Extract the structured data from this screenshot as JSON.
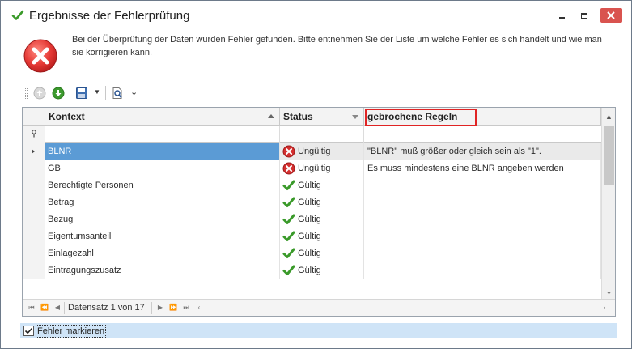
{
  "window": {
    "title": "Ergebnisse der Fehlerprüfung",
    "icon": "check-icon",
    "controls": [
      "minimize-icon",
      "maximize-icon",
      "close-icon"
    ]
  },
  "message": {
    "icon": "error-icon",
    "text": "Bei der Überprüfung der Daten wurden Fehler gefunden. Bitte entnehmen Sie der Liste um welche Fehler es sich handelt und wie man sie korrigieren kann."
  },
  "toolbar": {
    "icons": [
      "up-arrow-icon",
      "down-arrow-icon",
      "save-icon",
      "dropdown-arrow-icon",
      "search-document-icon",
      "chevron-down-icon"
    ]
  },
  "grid": {
    "columns": [
      "Kontext",
      "Status",
      "gebrochene Regeln"
    ],
    "rows": [
      {
        "kontext": "BLNR",
        "status": "Ungültig",
        "status_kind": "invalid",
        "regel": "\"BLNR\" muß größer oder gleich sein als \"1\"."
      },
      {
        "kontext": "GB",
        "status": "Ungültig",
        "status_kind": "invalid",
        "regel": "Es muss mindestens eine BLNR angeben werden"
      },
      {
        "kontext": "Berechtigte Personen",
        "status": "Gültig",
        "status_kind": "valid",
        "regel": ""
      },
      {
        "kontext": "Betrag",
        "status": "Gültig",
        "status_kind": "valid",
        "regel": ""
      },
      {
        "kontext": "Bezug",
        "status": "Gültig",
        "status_kind": "valid",
        "regel": ""
      },
      {
        "kontext": "Eigentumsanteil",
        "status": "Gültig",
        "status_kind": "valid",
        "regel": ""
      },
      {
        "kontext": "Einlagezahl",
        "status": "Gültig",
        "status_kind": "valid",
        "regel": ""
      },
      {
        "kontext": "Eintragungszusatz",
        "status": "Gültig",
        "status_kind": "valid",
        "regel": ""
      }
    ],
    "navigator": {
      "record_text": "Datensatz 1 von 17"
    }
  },
  "mark_errors": {
    "label": "Fehler markieren",
    "checked": true
  },
  "colors": {
    "selection": "#5b9bd5",
    "highlight_border": "#e02424",
    "checkbar": "#cfe4f7"
  }
}
